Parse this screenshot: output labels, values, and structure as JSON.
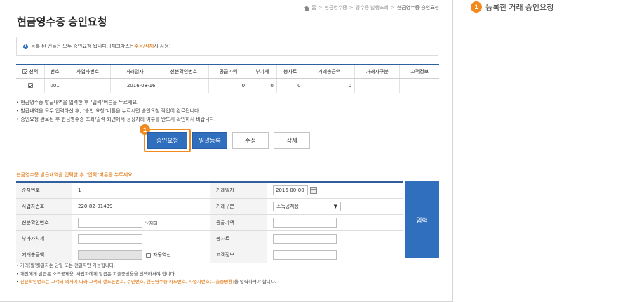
{
  "breadcrumb": {
    "home": "홈",
    "items": [
      "현금영수증",
      "영수증 발행조회",
      "현금영수증 승인요청"
    ]
  },
  "page_title": "현금영수증 승인요청",
  "notice": {
    "text_before": "등록 된 건들은 모두 승인요청 됩니다. (체크박스는 ",
    "highlight": "수정/삭제",
    "text_after": "시 사용)"
  },
  "table": {
    "headers": [
      "선택",
      "번호",
      "사업자번호",
      "거래일자",
      "신분확인번호",
      "공급가액",
      "부가세",
      "봉사료",
      "거래총금액",
      "거래자구분",
      "고객정보"
    ],
    "rows": [
      {
        "checked": true,
        "no": "001",
        "biz": "",
        "date": "2016-08-16",
        "id": "",
        "supply": "0",
        "vat": "0",
        "service": "0",
        "total": "0",
        "type": "",
        "customer": ""
      }
    ]
  },
  "notes_top": [
    "현금영수증 발급내역을 입력한 후 \"입력\"버튼을 누르세요.",
    "발급내역을 모두 입력하신 후, \"승인 요청\"버튼을 누르시면 승인요청 작업이 완료됩니다.",
    "승인요청 완료된 후 현금영수증 조회/출력 화면에서 정상처리 여부를 반드시 확인하시 바랍니다."
  ],
  "buttons": {
    "approve": "승인요청",
    "bulk": "일괄등록",
    "edit": "수정",
    "delete": "삭제"
  },
  "form": {
    "heading": "현금영수증 발급내역을 입력한 후 \"입력\"버튼을 누르세요.",
    "seq_label": "순차번호",
    "seq_value": "1",
    "date_label": "거래일자",
    "date_value": "2016-00-00",
    "biz_label": "사업자번호",
    "biz_value": "220-82-01439",
    "type_label": "거래구분",
    "type_value": "소득공제용",
    "id_label": "신분확인번호",
    "id_hint": "'-'제외",
    "supply_label": "공급가액",
    "vat_label": "부가가치세",
    "service_label": "봉사료",
    "total_label": "거래총금액",
    "auto_calc": "자동역산",
    "customer_label": "고객정보",
    "submit": "입력"
  },
  "notes_bottom": [
    {
      "text": "거래(발행)일자는 당일 또는 전일자만 가능합니다.",
      "highlight": false
    },
    {
      "text": "개인에게 발급은 소득공제용, 사업자에게 발급은 지출증빙용을 선택하셔야 합니다.",
      "highlight": false
    },
    {
      "text": "신분확인번호는 고객의 의사에 따라 고객의 핸드폰번호, 주민번호, 현금영수증 카드번호, 사업자번호(지출증빙용)",
      "highlight": true,
      "tail": "을 입력하셔야 합니다."
    }
  ],
  "callout": {
    "badge": "1",
    "text": "등록한 거래 승인요청"
  },
  "colors": {
    "accent": "#2f6fbd",
    "highlight": "#f08a1c",
    "warning_text": "#e06c00"
  }
}
